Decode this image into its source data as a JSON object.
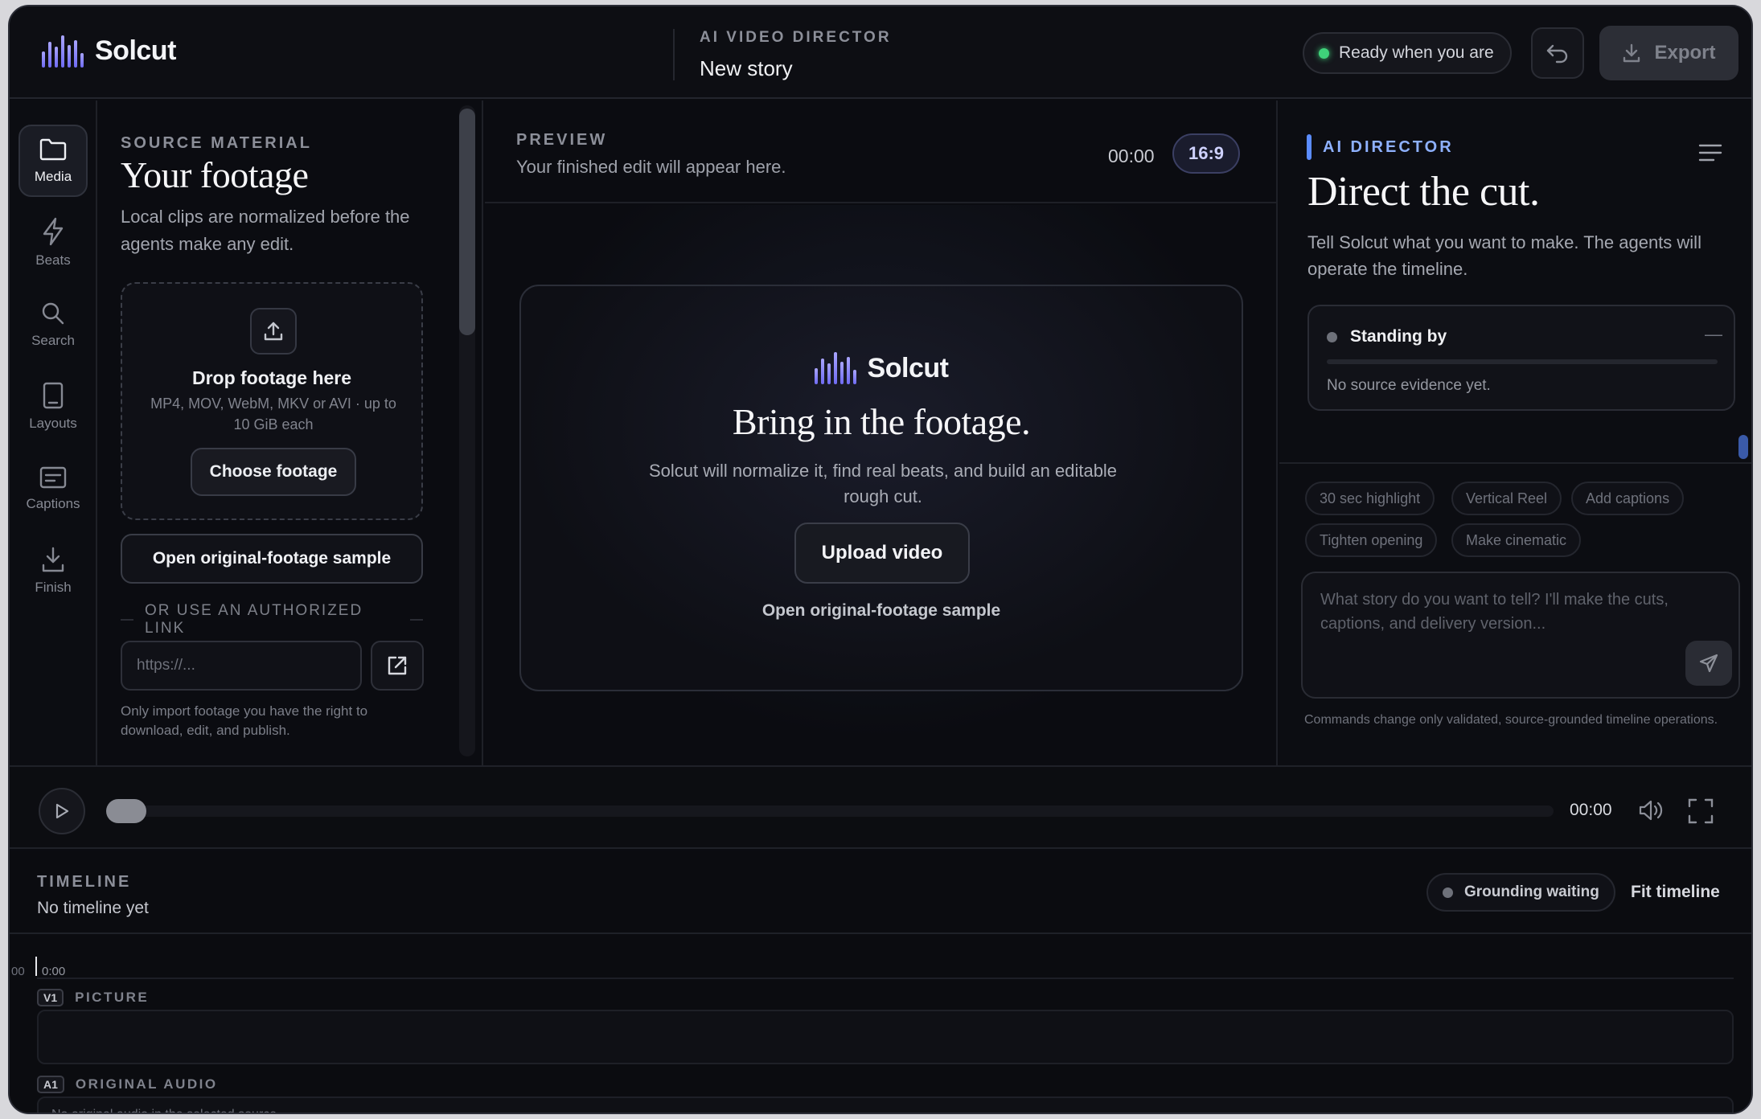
{
  "app": {
    "name": "Solcut",
    "eyebrow": "AI VIDEO DIRECTOR",
    "story_title": "New story",
    "status": "Ready when you are",
    "export_label": "Export",
    "accent": "#6f6bf2",
    "status_color": "#3fd27a"
  },
  "rail": {
    "items": [
      {
        "label": "Media",
        "icon": "folder-icon",
        "active": true
      },
      {
        "label": "Beats",
        "icon": "lightning-icon"
      },
      {
        "label": "Search",
        "icon": "search-icon"
      },
      {
        "label": "Layouts",
        "icon": "layout-icon"
      },
      {
        "label": "Captions",
        "icon": "captions-icon"
      },
      {
        "label": "Finish",
        "icon": "download-icon"
      }
    ]
  },
  "source": {
    "eyebrow": "SOURCE MATERIAL",
    "title": "Your footage",
    "description": "Local clips are normalized before the agents make any edit.",
    "drop_title": "Drop footage here",
    "drop_sub": "MP4, MOV, WebM, MKV or AVI · up to 10 GiB each",
    "choose_label": "Choose footage",
    "sample_label": "Open original-footage sample",
    "or_link": "OR USE AN AUTHORIZED LINK",
    "url_placeholder": "https://...",
    "legal": "Only import footage you have the right to download, edit, and publish."
  },
  "preview": {
    "eyebrow": "PREVIEW",
    "subtitle": "Your finished edit will appear here.",
    "time": "00:00",
    "ratio": "16:9",
    "card_brand": "Solcut",
    "card_title": "Bring in the footage.",
    "card_desc": "Solcut will normalize it, find real beats, and build an editable rough cut.",
    "upload_label": "Upload video",
    "sample_link": "Open original-footage sample"
  },
  "director": {
    "eyebrow": "AI DIRECTOR",
    "title": "Direct the cut.",
    "description": "Tell Solcut what you want to make. The agents will operate the timeline.",
    "status_title": "Standing by",
    "status_dash": "—",
    "status_detail": "No source evidence yet.",
    "chips": [
      "30 sec highlight",
      "Vertical Reel",
      "Add captions",
      "Tighten opening",
      "Make cinematic"
    ],
    "prompt_placeholder": "What story do you want to tell? I'll make the cuts, captions, and delivery version...",
    "footnote": "Commands change only validated, source-grounded timeline operations."
  },
  "player": {
    "time": "00:00"
  },
  "timeline": {
    "eyebrow": "TIMELINE",
    "subtitle": "No timeline yet",
    "grounding": "Grounding waiting",
    "fit_label": "Fit timeline",
    "ruler_left": "00",
    "ruler_start": "0:00",
    "tracks": [
      {
        "tag": "V1",
        "name": "PICTURE",
        "empty": ""
      },
      {
        "tag": "A1",
        "name": "ORIGINAL AUDIO",
        "empty": "No original audio in the selected source."
      }
    ]
  }
}
